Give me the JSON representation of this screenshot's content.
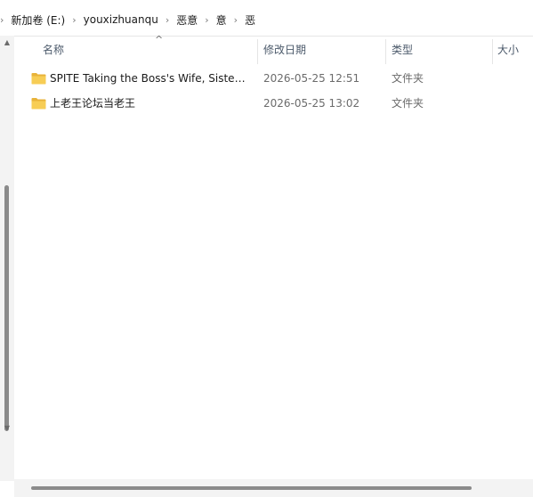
{
  "breadcrumb": {
    "lead_icon": "chevron-right-icon",
    "items": [
      "新加卷 (E:)",
      "youxizhuanqu",
      "恶意",
      "意",
      "恶"
    ],
    "separator": "›"
  },
  "columns": {
    "name": "名称",
    "date": "修改日期",
    "type": "类型",
    "size": "大小",
    "sort_icon": "caret-up-icon"
  },
  "rows": [
    {
      "icon": "folder-icon",
      "name": "SPITE Taking the Boss's Wife, Sister ...",
      "date": "2026-05-25 12:51",
      "type": "文件夹"
    },
    {
      "icon": "folder-icon",
      "name": "上老王论坛当老王",
      "date": "2026-05-25 13:02",
      "type": "文件夹"
    }
  ],
  "colors": {
    "folder": "#f2c94c",
    "header_text": "#4c5a6b",
    "secondary_text": "#6b6b6b"
  }
}
